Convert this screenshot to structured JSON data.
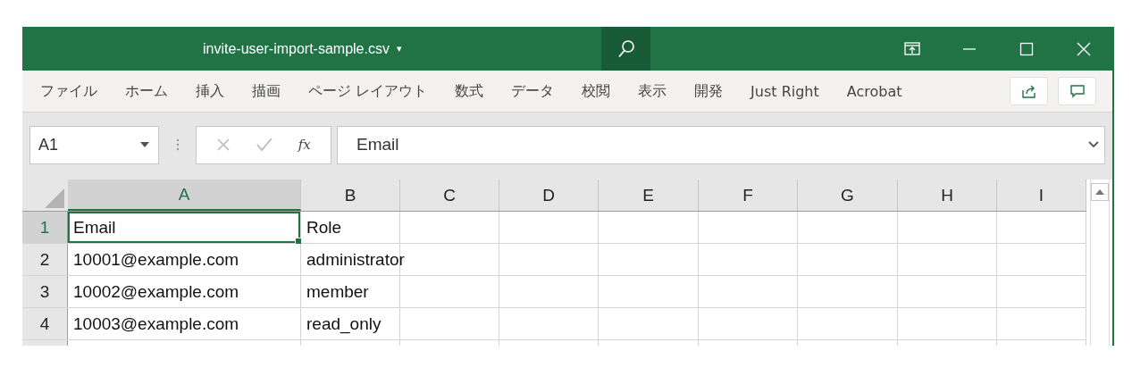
{
  "window": {
    "title": "invite-user-import-sample.csv",
    "title_caret": "▾"
  },
  "ribbon_tabs": [
    {
      "label": "ファイル"
    },
    {
      "label": "ホーム"
    },
    {
      "label": "挿入"
    },
    {
      "label": "描画"
    },
    {
      "label": "ページ レイアウト"
    },
    {
      "label": "数式"
    },
    {
      "label": "データ"
    },
    {
      "label": "校閲"
    },
    {
      "label": "表示"
    },
    {
      "label": "開発"
    },
    {
      "label": "Just Right"
    },
    {
      "label": "Acrobat"
    }
  ],
  "name_box": {
    "value": "A1"
  },
  "formula_bar": {
    "function_label": "fx",
    "value": "Email"
  },
  "sheet": {
    "columns": [
      "A",
      "B",
      "C",
      "D",
      "E",
      "F",
      "G",
      "H",
      "I"
    ],
    "rows": [
      {
        "number": "1",
        "cells": [
          {
            "text": "Email",
            "selected": true
          },
          {
            "text": "Role",
            "selected": false
          }
        ]
      },
      {
        "number": "2",
        "cells": [
          {
            "text": "10001@example.com",
            "selected": false
          },
          {
            "text": "administrator",
            "selected": false
          }
        ]
      },
      {
        "number": "3",
        "cells": [
          {
            "text": "10002@example.com",
            "selected": false
          },
          {
            "text": "member",
            "selected": false
          }
        ]
      },
      {
        "number": "4",
        "cells": [
          {
            "text": "10003@example.com",
            "selected": false
          },
          {
            "text": "read_only",
            "selected": false
          }
        ]
      }
    ]
  }
}
